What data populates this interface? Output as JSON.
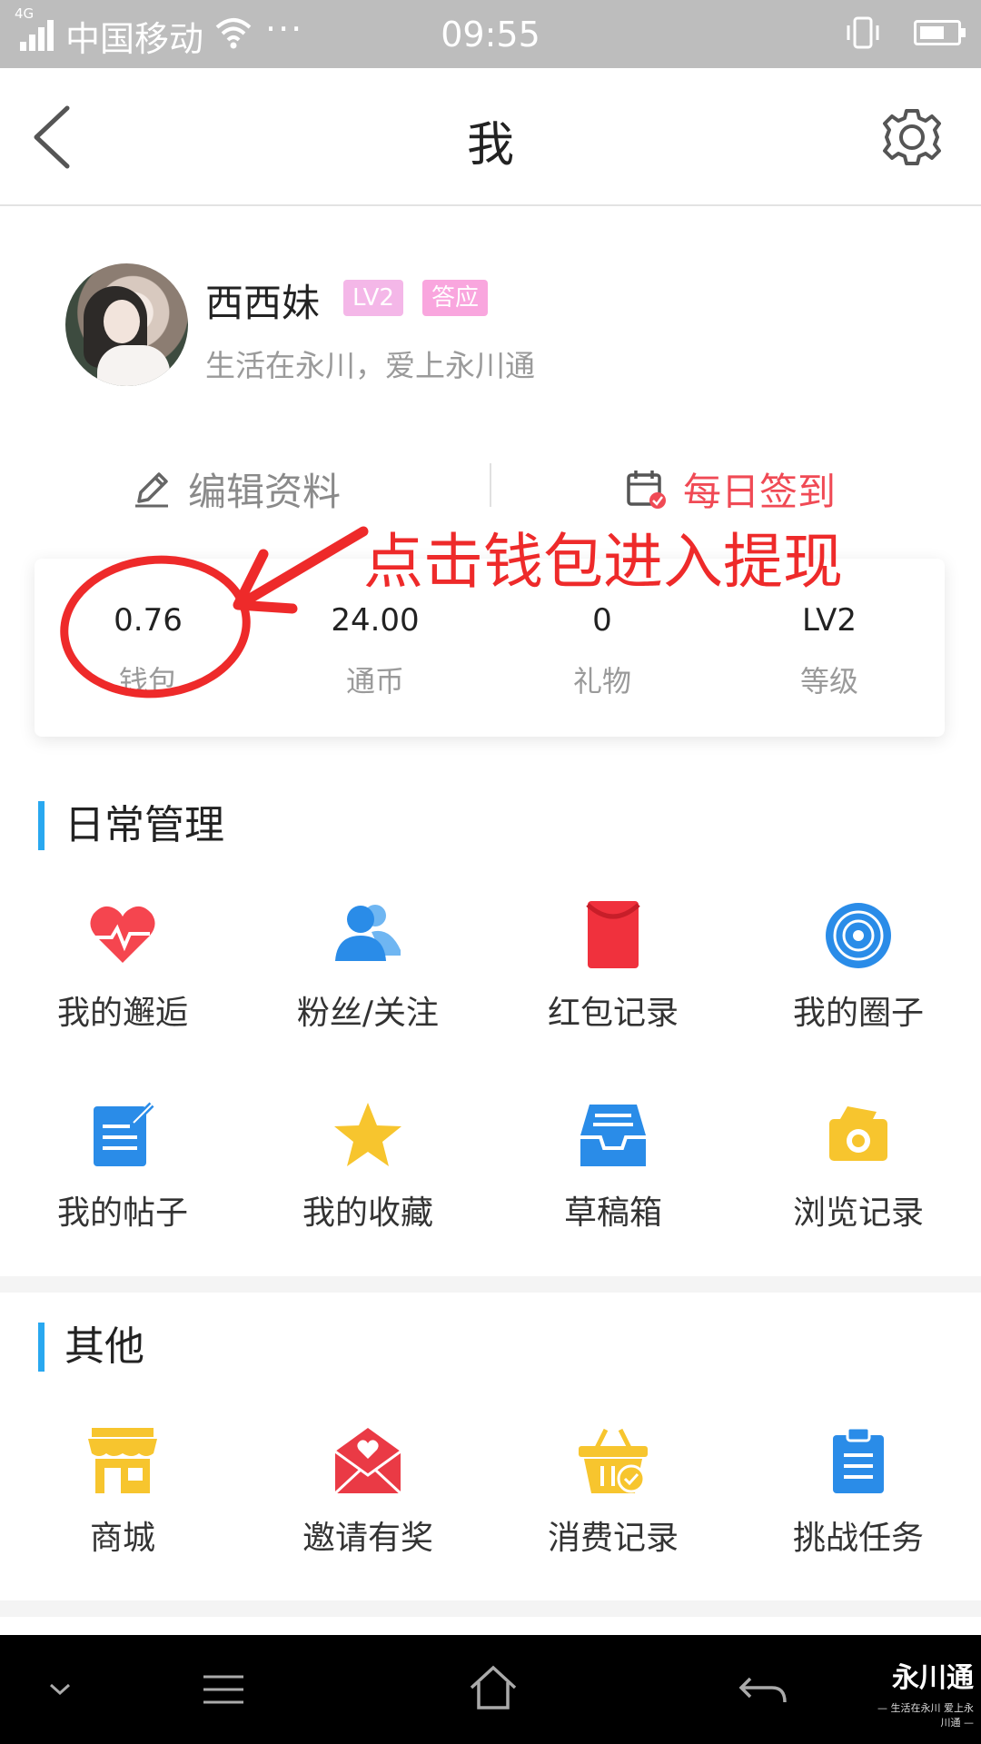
{
  "status_bar": {
    "network": "4G",
    "carrier": "中国移动",
    "more": "···",
    "time": "09:55"
  },
  "header": {
    "title": "我"
  },
  "profile": {
    "name": "西西妹",
    "level_badge": "LV2",
    "sign_badge": "答应",
    "motto": "生活在永川，爱上永川通",
    "edit_label": "编辑资料",
    "checkin_label": "每日签到"
  },
  "stats": [
    {
      "value": "0.76",
      "label": "钱包"
    },
    {
      "value": "24.00",
      "label": "通币"
    },
    {
      "value": "0",
      "label": "礼物"
    },
    {
      "value": "LV2",
      "label": "等级"
    }
  ],
  "annotation": {
    "text": "点击钱包进入提现"
  },
  "daily": {
    "title": "日常管理",
    "items": [
      {
        "label": "我的邂逅",
        "icon": "heart-pulse-icon"
      },
      {
        "label": "粉丝/关注",
        "icon": "users-icon"
      },
      {
        "label": "红包记录",
        "icon": "red-envelope-icon"
      },
      {
        "label": "我的圈子",
        "icon": "circle-target-icon"
      },
      {
        "label": "我的帖子",
        "icon": "post-edit-icon"
      },
      {
        "label": "我的收藏",
        "icon": "star-icon"
      },
      {
        "label": "草稿箱",
        "icon": "inbox-tray-icon"
      },
      {
        "label": "浏览记录",
        "icon": "camera-history-icon"
      }
    ]
  },
  "other": {
    "title": "其他",
    "items": [
      {
        "label": "商城",
        "icon": "shop-icon"
      },
      {
        "label": "邀请有奖",
        "icon": "invite-envelope-icon"
      },
      {
        "label": "消费记录",
        "icon": "basket-check-icon"
      },
      {
        "label": "挑战任务",
        "icon": "clipboard-icon"
      }
    ]
  },
  "watermark": {
    "brand": "永川通",
    "tagline": "— 生活在永川 爱上永川通 —"
  },
  "colors": {
    "accent_blue": "#29a8f0",
    "accent_red": "#f04a55",
    "annotation_red": "#ee2a2a",
    "badge_pink": "#f4b7e8",
    "icon_yellow": "#f7c52e"
  }
}
